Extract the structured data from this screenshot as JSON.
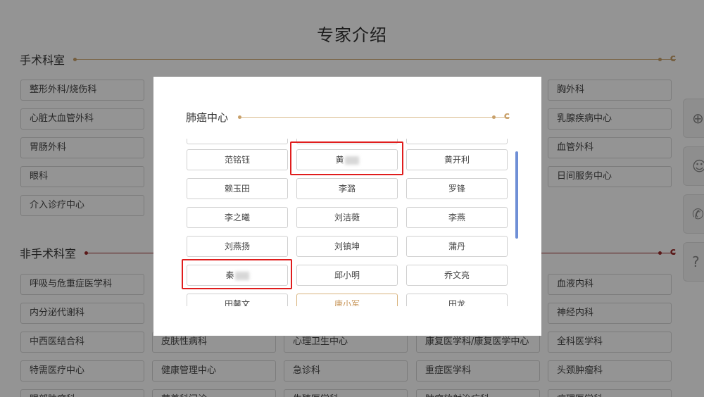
{
  "page": {
    "title": "专家介绍"
  },
  "surgery": {
    "title": "手术科室",
    "col1": [
      "整形外科/烧伤科",
      "心脏大血管外科",
      "胃肠外科",
      "眼科",
      "介入诊疗中心"
    ],
    "col5": [
      "胸外科",
      "乳腺疾病中心",
      "血管外科",
      "日间服务中心"
    ]
  },
  "nonsurgery": {
    "title": "非手术科室",
    "col1": [
      "呼吸与危重症医学科",
      "内分泌代谢科",
      "中西医结合科",
      "特需医疗中心",
      "眼部肿瘤科"
    ],
    "col5": [
      "血液内科",
      "神经内科",
      "全科医学科",
      "头颈肿瘤科",
      "病理医学科"
    ],
    "row3": [
      "皮肤性病科",
      "心理卫生中心",
      "康复医学科/康复医学中心"
    ],
    "row4": [
      "健康管理中心",
      "急诊科",
      "重症医学科"
    ],
    "row5": [
      "营养科门诊",
      "生殖医学科",
      "肿瘤放射治疗科"
    ]
  },
  "side_icons": [
    "hospital-plus-icon",
    "doctor-chat-icon",
    "phone-icon",
    "help-icon"
  ],
  "modal": {
    "title": "肺癌中心",
    "doctors": [
      [
        "范铭钰",
        "黄",
        "黄开利"
      ],
      [
        "赖玉田",
        "李潞",
        "罗锋"
      ],
      [
        "李之曦",
        "刘洁薇",
        "李燕"
      ],
      [
        "刘燕扬",
        "刘镇坤",
        "蒲丹"
      ],
      [
        "秦",
        "邱小明",
        "乔文亮"
      ],
      [
        "田馨文",
        "唐小军",
        "田龙"
      ]
    ]
  }
}
